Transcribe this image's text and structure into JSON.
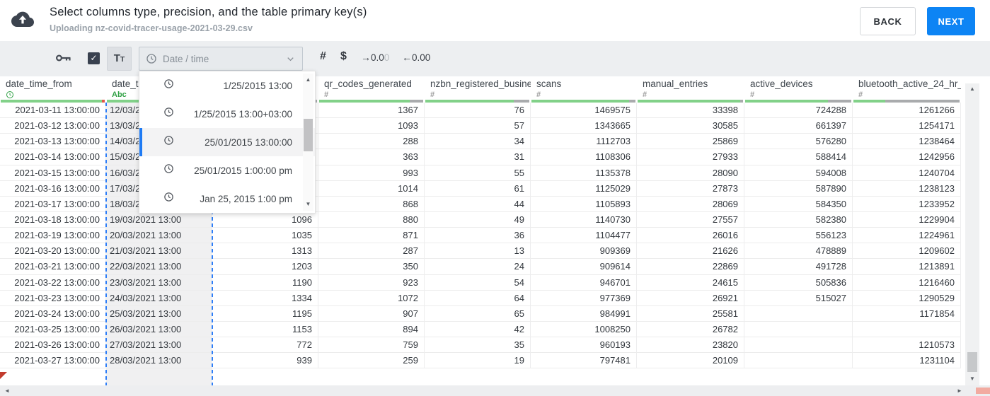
{
  "colors": {
    "accent_blue": "#0d84f4",
    "bar_green": "#82d189",
    "bar_gray": "#a9abad",
    "bar_red": "#e0564a",
    "dashed_blue": "#2e7ef7",
    "type_green": "#2fa144",
    "type_gray": "#9b9b9b",
    "selected_column_bg": "#f0f0f1",
    "h_thumb_pink": "#f2aba1"
  },
  "header": {
    "title": "Select columns type, precision, and the table primary key(s)",
    "subtitle": "Uploading nz-covid-tracer-usage-2021-03-29.csv",
    "back_label": "BACK",
    "next_label": "NEXT"
  },
  "toolbar": {
    "checkbox_checked": true,
    "check_glyph": "✓",
    "tt_big": "T",
    "tt_small": "T",
    "type_select_label": "Date / time",
    "number_glyph": "#",
    "currency_glyph": "$",
    "increase_decimal": {
      "arrow": "→",
      "dark": "0.0",
      "light": "0"
    },
    "decrease_decimal": {
      "arrow": "←",
      "text": "0.00"
    }
  },
  "format_dropdown": {
    "options": [
      {
        "label": "1/25/2015 13:00",
        "selected": false
      },
      {
        "label": "1/25/2015 13:00+03:00",
        "selected": false
      },
      {
        "label": "25/01/2015 13:00:00",
        "selected": true
      },
      {
        "label": "25/01/2015 1:00:00 pm",
        "selected": false
      },
      {
        "label": "Jan 25, 2015 1:00 pm",
        "selected": false
      }
    ]
  },
  "table": {
    "columns": [
      {
        "name": "date_time_from",
        "type_icon": "clock",
        "align": "right",
        "selected": false,
        "bar": [
          [
            "green",
            0.97
          ],
          [
            "red",
            0.03
          ]
        ]
      },
      {
        "name": "date_t",
        "type_icon": "Abc",
        "align": "left",
        "selected": true,
        "bar": [
          [
            "green",
            1.0
          ]
        ]
      },
      {
        "name": "",
        "type_icon": "",
        "align": "right",
        "selected": false,
        "bar": [
          [
            "green",
            0.9
          ],
          [
            "gray",
            0.1
          ]
        ]
      },
      {
        "name": "qr_codes_generated",
        "type_icon": "#",
        "align": "right",
        "selected": false,
        "bar": [
          [
            "green",
            0.87
          ],
          [
            "gray",
            0.13
          ]
        ]
      },
      {
        "name": "nzbn_registered_busine",
        "type_icon": "#",
        "align": "right",
        "selected": false,
        "bar": [
          [
            "green",
            0.85
          ],
          [
            "gray",
            0.15
          ]
        ]
      },
      {
        "name": "scans",
        "type_icon": "#",
        "align": "right",
        "selected": false,
        "bar": [
          [
            "green",
            0.94
          ],
          [
            "gray",
            0.06
          ]
        ]
      },
      {
        "name": "manual_entries",
        "type_icon": "#",
        "align": "right",
        "selected": false,
        "bar": [
          [
            "green",
            0.97
          ],
          [
            "gray",
            0.03
          ]
        ]
      },
      {
        "name": "active_devices",
        "type_icon": "#",
        "align": "right",
        "selected": false,
        "bar": [
          [
            "green",
            0.78
          ],
          [
            "gray",
            0.22
          ]
        ]
      },
      {
        "name": "bluetooth_active_24_hr_",
        "type_icon": "#",
        "align": "right",
        "selected": false,
        "bar": [
          [
            "green",
            0.3
          ],
          [
            "gray",
            0.7
          ]
        ]
      }
    ],
    "rows": [
      [
        "2021-03-11 13:00:00",
        "12/03/2",
        "",
        "1367",
        "76",
        "1469575",
        "33398",
        "724288",
        "1261266"
      ],
      [
        "2021-03-12 13:00:00",
        "13/03/2",
        "",
        "1093",
        "57",
        "1343665",
        "30585",
        "661397",
        "1254171"
      ],
      [
        "2021-03-13 13:00:00",
        "14/03/2",
        "",
        "288",
        "34",
        "1112703",
        "25869",
        "576280",
        "1238464"
      ],
      [
        "2021-03-14 13:00:00",
        "15/03/2",
        "",
        "363",
        "31",
        "1108306",
        "27933",
        "588414",
        "1242956"
      ],
      [
        "2021-03-15 13:00:00",
        "16/03/2",
        "",
        "993",
        "55",
        "1135378",
        "28090",
        "594008",
        "1240704"
      ],
      [
        "2021-03-16 13:00:00",
        "17/03/2",
        "",
        "1014",
        "61",
        "1125029",
        "27873",
        "587890",
        "1238123"
      ],
      [
        "2021-03-17 13:00:00",
        "18/03/2",
        "",
        "868",
        "44",
        "1105893",
        "28069",
        "584350",
        "1233952"
      ],
      [
        "2021-03-18 13:00:00",
        "19/03/2021 13:00",
        "1096",
        "880",
        "49",
        "1140730",
        "27557",
        "582380",
        "1229904"
      ],
      [
        "2021-03-19 13:00:00",
        "20/03/2021 13:00",
        "1035",
        "871",
        "36",
        "1104477",
        "26016",
        "556123",
        "1224961"
      ],
      [
        "2021-03-20 13:00:00",
        "21/03/2021 13:00",
        "1313",
        "287",
        "13",
        "909369",
        "21626",
        "478889",
        "1209602"
      ],
      [
        "2021-03-21 13:00:00",
        "22/03/2021 13:00",
        "1203",
        "350",
        "24",
        "909614",
        "22869",
        "491728",
        "1213891"
      ],
      [
        "2021-03-22 13:00:00",
        "23/03/2021 13:00",
        "1190",
        "923",
        "54",
        "946701",
        "24615",
        "505836",
        "1216460"
      ],
      [
        "2021-03-23 13:00:00",
        "24/03/2021 13:00",
        "1334",
        "1072",
        "64",
        "977369",
        "26921",
        "515027",
        "1290529"
      ],
      [
        "2021-03-24 13:00:00",
        "25/03/2021 13:00",
        "1195",
        "907",
        "65",
        "984991",
        "25581",
        "",
        "1171854"
      ],
      [
        "2021-03-25 13:00:00",
        "26/03/2021 13:00",
        "1153",
        "894",
        "42",
        "1008250",
        "26782",
        "",
        ""
      ],
      [
        "2021-03-26 13:00:00",
        "27/03/2021 13:00",
        "772",
        "759",
        "35",
        "960193",
        "23820",
        "",
        ""
      ],
      [
        "2021-03-27 13:00:00",
        "28/03/2021 13:00",
        "939",
        "259",
        "19",
        "797481",
        "20109",
        "",
        ""
      ]
    ],
    "rows_extra": {
      "r16_bt": "1210573",
      "r17_bt": "1231104"
    }
  },
  "scroll": {
    "up_glyph": "▲",
    "down_glyph": "▼",
    "left_glyph": "◄",
    "right_glyph": "►"
  }
}
